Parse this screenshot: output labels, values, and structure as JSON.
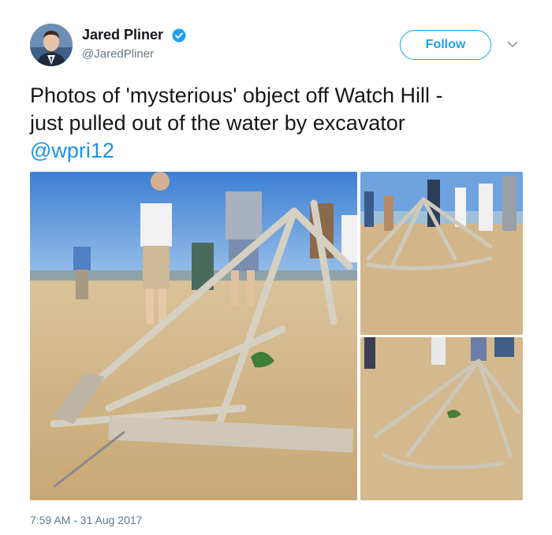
{
  "author": {
    "display_name": "Jared Pliner",
    "handle": "@JaredPliner",
    "verified_icon": "verified-badge-icon",
    "avatar_icon": "profile-photo"
  },
  "follow_button": {
    "label": "Follow"
  },
  "menu_icon": "chevron-down-icon",
  "tweet": {
    "line1": "Photos of 'mysterious' object off Watch Hill -",
    "line2": "just pulled out of the water by excavator",
    "mention": "@wpri12"
  },
  "media": {
    "count": 3,
    "photos": [
      "photo-main",
      "photo-top-right",
      "photo-bottom-right"
    ]
  },
  "timestamp": "7:59 AM - 31 Aug 2017",
  "colors": {
    "accent": "#1da1f2",
    "link": "#1b95e0",
    "text": "#14171a",
    "secondary": "#657786"
  }
}
